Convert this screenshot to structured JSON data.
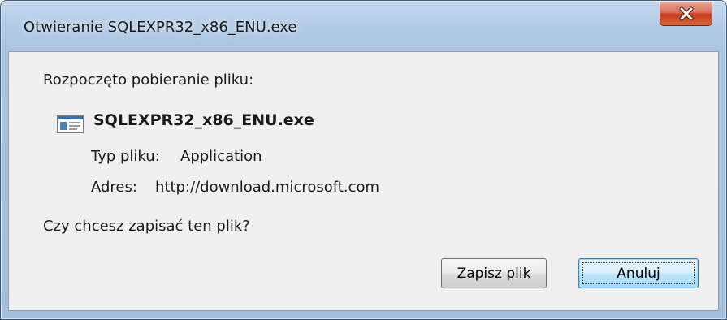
{
  "window": {
    "title": "Otwieranie SQLEXPR32_x86_ENU.exe",
    "close_icon": "close-icon"
  },
  "dialog": {
    "intro": "Rozpoczęto pobieranie pliku:",
    "file_icon": "application-file-icon",
    "file_name": "SQLEXPR32_x86_ENU.exe",
    "type_label": "Typ pliku:",
    "type_value": "Application",
    "address_label": "Adres:",
    "address_value": "http://download.microsoft.com",
    "question": "Czy chcesz zapisać ten plik?",
    "save_label": "Zapisz plik",
    "cancel_label": "Anuluj"
  },
  "colors": {
    "frame": "#b3cce6",
    "client": "#f0f0f0",
    "close_button": "#c43b1f",
    "default_button_border": "#3c7fb1"
  }
}
